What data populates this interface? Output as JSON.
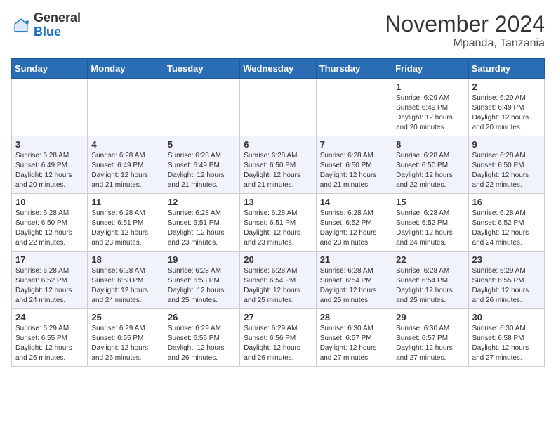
{
  "logo": {
    "general": "General",
    "blue": "Blue"
  },
  "title": "November 2024",
  "subtitle": "Mpanda, Tanzania",
  "days_header": [
    "Sunday",
    "Monday",
    "Tuesday",
    "Wednesday",
    "Thursday",
    "Friday",
    "Saturday"
  ],
  "weeks": [
    [
      {
        "num": "",
        "info": ""
      },
      {
        "num": "",
        "info": ""
      },
      {
        "num": "",
        "info": ""
      },
      {
        "num": "",
        "info": ""
      },
      {
        "num": "",
        "info": ""
      },
      {
        "num": "1",
        "info": "Sunrise: 6:29 AM\nSunset: 6:49 PM\nDaylight: 12 hours and 20 minutes."
      },
      {
        "num": "2",
        "info": "Sunrise: 6:29 AM\nSunset: 6:49 PM\nDaylight: 12 hours and 20 minutes."
      }
    ],
    [
      {
        "num": "3",
        "info": "Sunrise: 6:28 AM\nSunset: 6:49 PM\nDaylight: 12 hours and 20 minutes."
      },
      {
        "num": "4",
        "info": "Sunrise: 6:28 AM\nSunset: 6:49 PM\nDaylight: 12 hours and 21 minutes."
      },
      {
        "num": "5",
        "info": "Sunrise: 6:28 AM\nSunset: 6:49 PM\nDaylight: 12 hours and 21 minutes."
      },
      {
        "num": "6",
        "info": "Sunrise: 6:28 AM\nSunset: 6:50 PM\nDaylight: 12 hours and 21 minutes."
      },
      {
        "num": "7",
        "info": "Sunrise: 6:28 AM\nSunset: 6:50 PM\nDaylight: 12 hours and 21 minutes."
      },
      {
        "num": "8",
        "info": "Sunrise: 6:28 AM\nSunset: 6:50 PM\nDaylight: 12 hours and 22 minutes."
      },
      {
        "num": "9",
        "info": "Sunrise: 6:28 AM\nSunset: 6:50 PM\nDaylight: 12 hours and 22 minutes."
      }
    ],
    [
      {
        "num": "10",
        "info": "Sunrise: 6:28 AM\nSunset: 6:50 PM\nDaylight: 12 hours and 22 minutes."
      },
      {
        "num": "11",
        "info": "Sunrise: 6:28 AM\nSunset: 6:51 PM\nDaylight: 12 hours and 23 minutes."
      },
      {
        "num": "12",
        "info": "Sunrise: 6:28 AM\nSunset: 6:51 PM\nDaylight: 12 hours and 23 minutes."
      },
      {
        "num": "13",
        "info": "Sunrise: 6:28 AM\nSunset: 6:51 PM\nDaylight: 12 hours and 23 minutes."
      },
      {
        "num": "14",
        "info": "Sunrise: 6:28 AM\nSunset: 6:52 PM\nDaylight: 12 hours and 23 minutes."
      },
      {
        "num": "15",
        "info": "Sunrise: 6:28 AM\nSunset: 6:52 PM\nDaylight: 12 hours and 24 minutes."
      },
      {
        "num": "16",
        "info": "Sunrise: 6:28 AM\nSunset: 6:52 PM\nDaylight: 12 hours and 24 minutes."
      }
    ],
    [
      {
        "num": "17",
        "info": "Sunrise: 6:28 AM\nSunset: 6:52 PM\nDaylight: 12 hours and 24 minutes."
      },
      {
        "num": "18",
        "info": "Sunrise: 6:28 AM\nSunset: 6:53 PM\nDaylight: 12 hours and 24 minutes."
      },
      {
        "num": "19",
        "info": "Sunrise: 6:28 AM\nSunset: 6:53 PM\nDaylight: 12 hours and 25 minutes."
      },
      {
        "num": "20",
        "info": "Sunrise: 6:28 AM\nSunset: 6:54 PM\nDaylight: 12 hours and 25 minutes."
      },
      {
        "num": "21",
        "info": "Sunrise: 6:28 AM\nSunset: 6:54 PM\nDaylight: 12 hours and 25 minutes."
      },
      {
        "num": "22",
        "info": "Sunrise: 6:28 AM\nSunset: 6:54 PM\nDaylight: 12 hours and 25 minutes."
      },
      {
        "num": "23",
        "info": "Sunrise: 6:29 AM\nSunset: 6:55 PM\nDaylight: 12 hours and 26 minutes."
      }
    ],
    [
      {
        "num": "24",
        "info": "Sunrise: 6:29 AM\nSunset: 6:55 PM\nDaylight: 12 hours and 26 minutes."
      },
      {
        "num": "25",
        "info": "Sunrise: 6:29 AM\nSunset: 6:55 PM\nDaylight: 12 hours and 26 minutes."
      },
      {
        "num": "26",
        "info": "Sunrise: 6:29 AM\nSunset: 6:56 PM\nDaylight: 12 hours and 26 minutes."
      },
      {
        "num": "27",
        "info": "Sunrise: 6:29 AM\nSunset: 6:56 PM\nDaylight: 12 hours and 26 minutes."
      },
      {
        "num": "28",
        "info": "Sunrise: 6:30 AM\nSunset: 6:57 PM\nDaylight: 12 hours and 27 minutes."
      },
      {
        "num": "29",
        "info": "Sunrise: 6:30 AM\nSunset: 6:57 PM\nDaylight: 12 hours and 27 minutes."
      },
      {
        "num": "30",
        "info": "Sunrise: 6:30 AM\nSunset: 6:58 PM\nDaylight: 12 hours and 27 minutes."
      }
    ]
  ]
}
